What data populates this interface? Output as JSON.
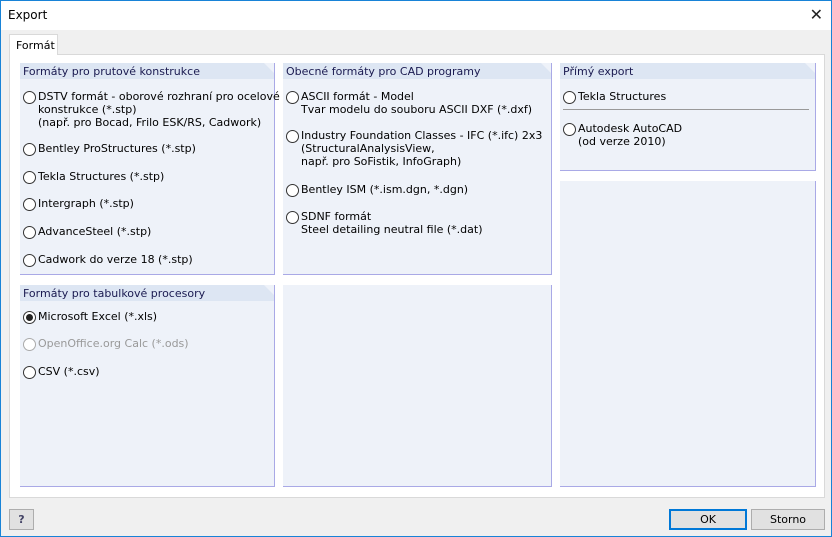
{
  "window": {
    "title": "Export",
    "close_icon": "close-icon"
  },
  "tab": {
    "label": "Formát"
  },
  "panels": {
    "beam": {
      "title": "Formáty pro prutové konstrukce",
      "options": [
        {
          "label": "DSTV formát - oborové rozhraní pro ocelové\nkonstrukce (*.stp)\n(např. pro Bocad, Frilo ESK/RS, Cadwork)"
        },
        {
          "label": "Bentley ProStructures (*.stp)"
        },
        {
          "label": "Tekla Structures (*.stp)"
        },
        {
          "label": "Intergraph (*.stp)"
        },
        {
          "label": "AdvanceSteel (*.stp)"
        },
        {
          "label": "Cadwork do verze 18 (*.stp)"
        }
      ]
    },
    "cad": {
      "title": "Obecné formáty pro CAD programy",
      "options": [
        {
          "label": "ASCII formát - Model\nTvar modelu do souboru ASCII DXF (*.dxf)"
        },
        {
          "label": "Industry Foundation Classes - IFC (*.ifc) 2x3\n(StructuralAnalysisView,\nnapř. pro SoFistik, InfoGraph)"
        },
        {
          "label": "Bentley ISM (*.ism.dgn, *.dgn)"
        },
        {
          "label": "SDNF formát\nSteel detailing neutral file (*.dat)"
        }
      ]
    },
    "direct": {
      "title": "Přímý export",
      "options": [
        {
          "label": "Tekla Structures"
        },
        {
          "label": "Autodesk AutoCAD\n(od verze 2010)"
        }
      ]
    },
    "table": {
      "title": "Formáty pro tabulkové procesory",
      "options": [
        {
          "label": "Microsoft Excel (*.xls)",
          "selected": true
        },
        {
          "label": "OpenOffice.org Calc (*.ods)",
          "disabled": true
        },
        {
          "label": "CSV (*.csv)"
        }
      ]
    }
  },
  "buttons": {
    "ok": "OK",
    "cancel": "Storno",
    "help_icon": "help-icon"
  }
}
